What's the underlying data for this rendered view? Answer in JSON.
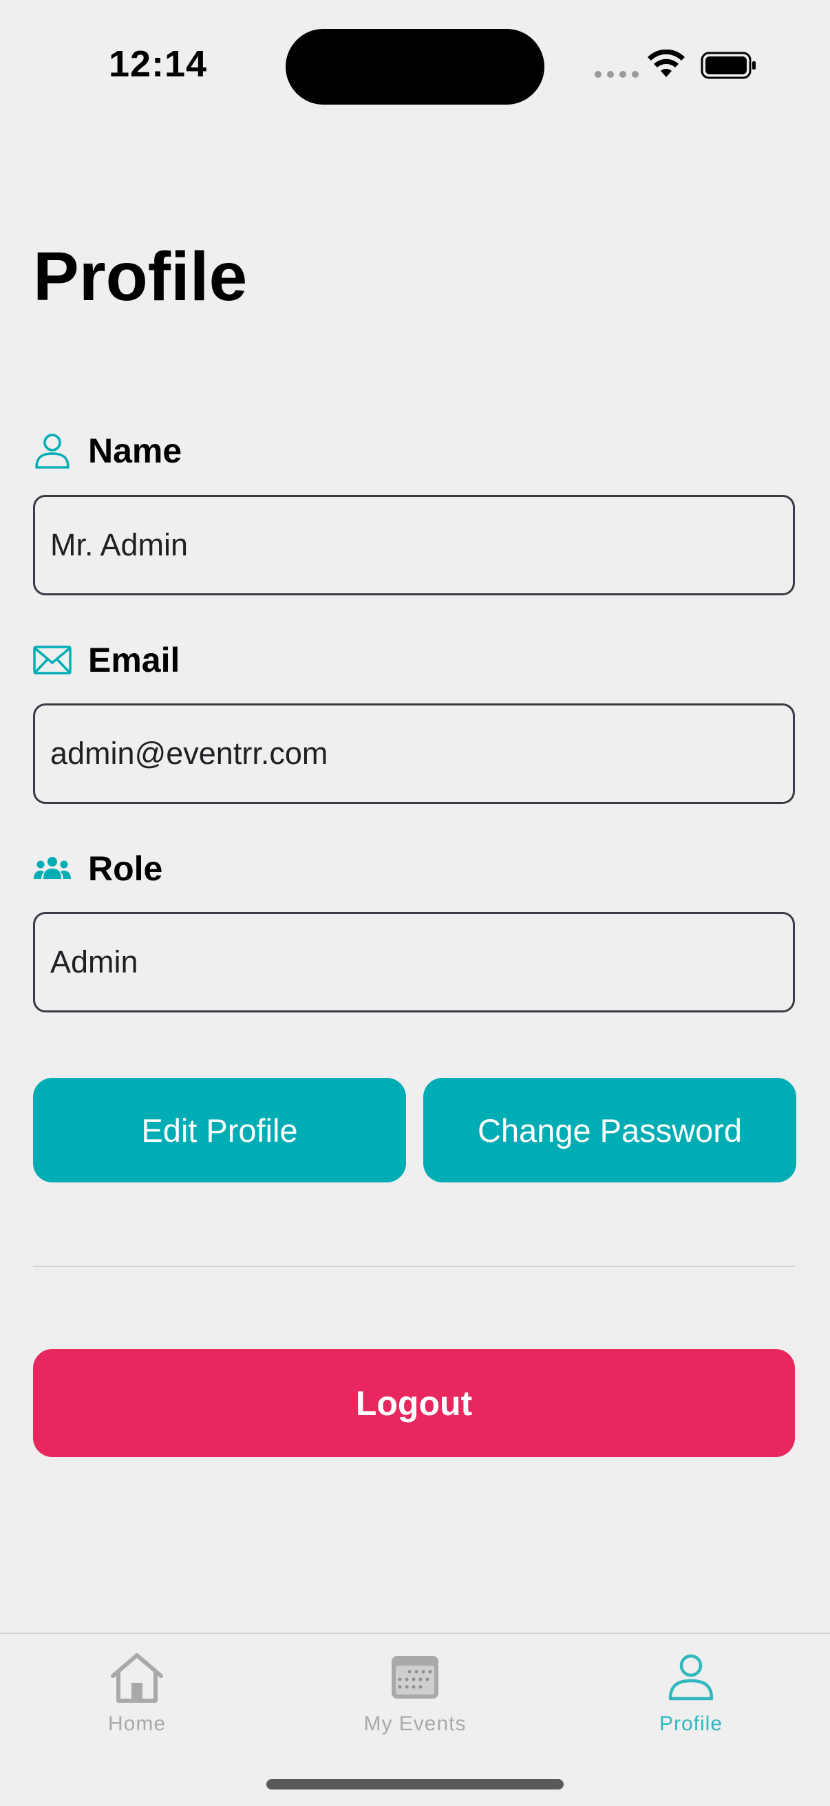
{
  "status_bar": {
    "time": "12:14"
  },
  "page": {
    "title": "Profile"
  },
  "fields": {
    "name": {
      "label": "Name",
      "value": "Mr. Admin",
      "icon": "person-icon"
    },
    "email": {
      "label": "Email",
      "value": "admin@eventrr.com",
      "icon": "mail-icon"
    },
    "role": {
      "label": "Role",
      "value": "Admin",
      "icon": "people-icon"
    }
  },
  "actions": {
    "edit_profile": "Edit Profile",
    "change_password": "Change Password",
    "logout": "Logout"
  },
  "tab_bar": {
    "items": [
      {
        "label": "Home",
        "icon": "house-icon",
        "active": false
      },
      {
        "label": "My Events",
        "icon": "calendar-icon",
        "active": false
      },
      {
        "label": "Profile",
        "icon": "person-icon",
        "active": true
      }
    ]
  },
  "colors": {
    "accent": "#00adb5",
    "danger": "#e8275f",
    "background": "#efefef",
    "tab_inactive": "#a9a9a9",
    "tab_active": "#30b7c0"
  }
}
